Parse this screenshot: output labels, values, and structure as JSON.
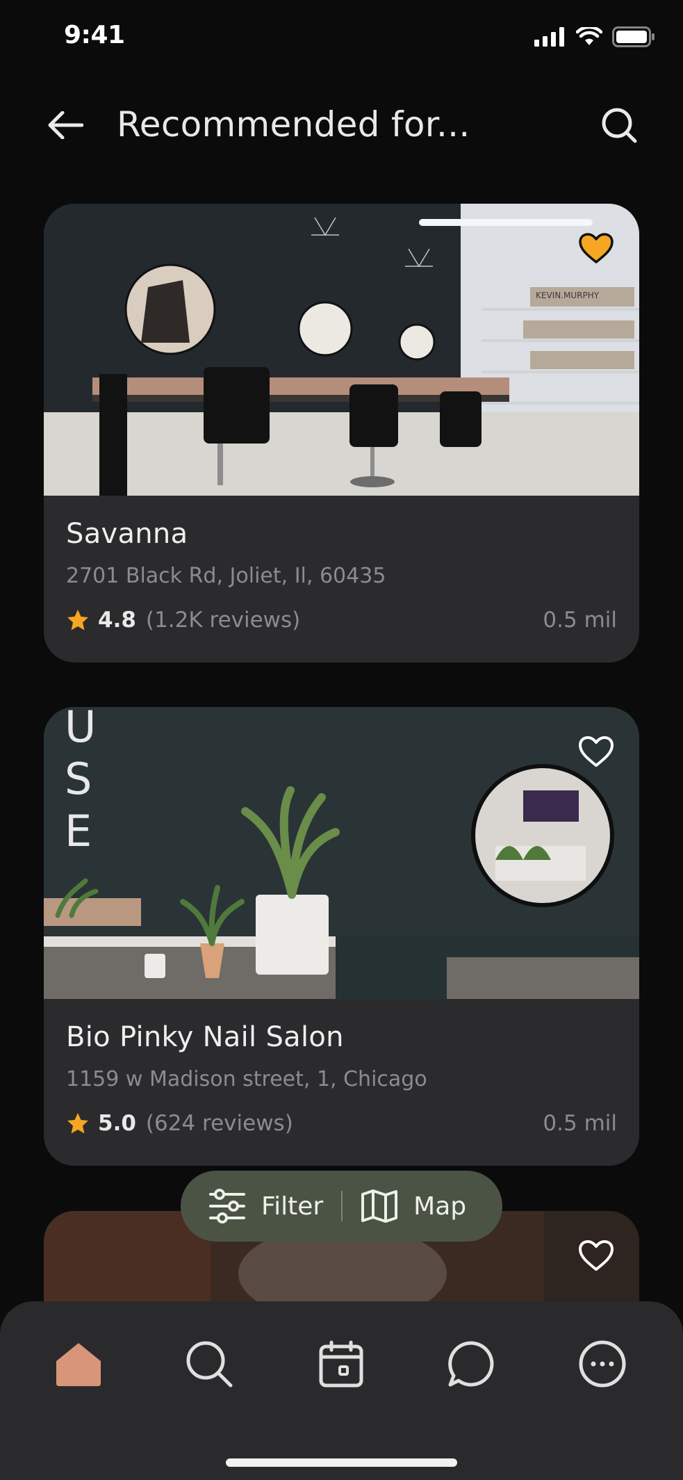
{
  "status": {
    "time": "9:41"
  },
  "header": {
    "title": "Recommended for..."
  },
  "cards": [
    {
      "name": "Savanna",
      "address": "2701 Black Rd, Joliet, Il, 60435",
      "rating": "4.8",
      "reviews": "(1.2K reviews)",
      "distance": "0.5 mil",
      "favorited": true
    },
    {
      "name": "Bio Pinky Nail Salon",
      "address": "1159 w Madison street, 1, Chicago",
      "rating": "5.0",
      "reviews": "(624 reviews)",
      "distance": "0.5 mil",
      "favorited": false
    },
    {
      "favorited": false
    }
  ],
  "pill": {
    "filter_label": "Filter",
    "map_label": "Map"
  },
  "tabs": [
    {
      "icon": "home-icon",
      "active": true
    },
    {
      "icon": "search-icon",
      "active": false
    },
    {
      "icon": "calendar-icon",
      "active": false
    },
    {
      "icon": "chat-icon",
      "active": false
    },
    {
      "icon": "more-icon",
      "active": false
    }
  ],
  "colors": {
    "accent": "#F5A623",
    "active_tab": "#D9957A",
    "pill_bg": "#4B5345",
    "card_bg": "#2B2B2D"
  }
}
